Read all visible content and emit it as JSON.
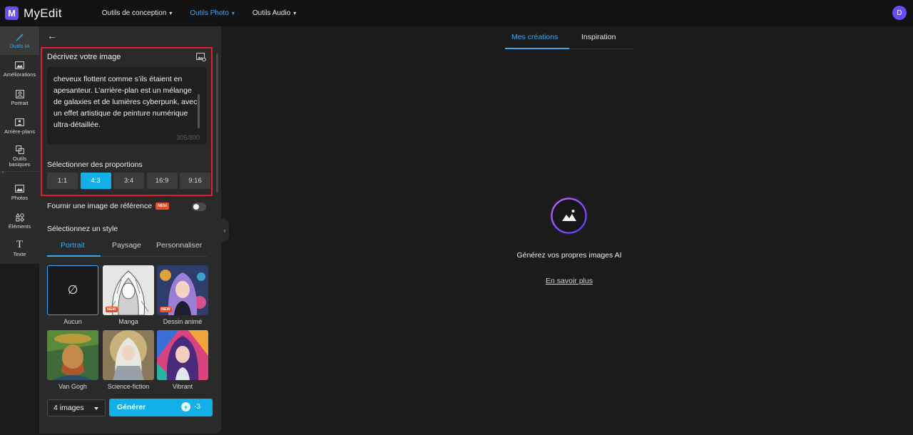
{
  "app": {
    "logo_mark": "M",
    "name": "MyEdit",
    "avatar_initial": "D"
  },
  "nav": [
    {
      "label": "Outils de conception",
      "active": false
    },
    {
      "label": "Outils Photo",
      "active": true
    },
    {
      "label": "Outils Audio",
      "active": false
    }
  ],
  "rail": {
    "ai": "Outils IA",
    "enhance": "Améliorations",
    "portrait": "Portrait",
    "backgrounds": "Arrière-plans",
    "basic": "Outils basiques",
    "photos": "Photos",
    "elements": "Éléments",
    "text": "Texte"
  },
  "panel": {
    "describe_title": "Décrivez votre image",
    "prompt_text": "cheveux flottent comme s’ils étaient en apesanteur. L’arrière-plan est un mélange de galaxies et de lumières cyberpunk, avec un effet artistique de peinture numérique ultra-détaillée.",
    "counter": "305/800",
    "ratio_title": "Sélectionner des proportions",
    "ratios": [
      "1:1",
      "4:3",
      "3:4",
      "16:9",
      "9:16"
    ],
    "ratio_selected": "4:3",
    "reference_label": "Fournir une image de référence",
    "new_badge": "NEW",
    "reference_enabled": false,
    "style_title": "Sélectionnez un style",
    "style_tabs": [
      "Portrait",
      "Paysage",
      "Personnaliser"
    ],
    "style_tab_active": "Portrait",
    "styles": [
      {
        "label": "Aucun",
        "new": false,
        "selected": true
      },
      {
        "label": "Manga",
        "new": true,
        "selected": false
      },
      {
        "label": "Dessin animé",
        "new": true,
        "selected": false
      },
      {
        "label": "Van Gogh",
        "new": false,
        "selected": false
      },
      {
        "label": "Science-fiction",
        "new": false,
        "selected": false
      },
      {
        "label": "Vibrant",
        "new": false,
        "selected": false
      }
    ],
    "image_count": "4 images",
    "generate_label": "Générer",
    "credit_cost": "-3"
  },
  "right": {
    "tabs": [
      "Mes créations",
      "Inspiration"
    ],
    "active_tab": "Mes créations",
    "empty_text": "Générez vos propres images AI",
    "learn_more": "En savoir plus"
  },
  "colors": {
    "accent": "#12b0e8",
    "link": "#3ba7f0",
    "brand": "#6a4cf5",
    "new_badge": "#f04a23",
    "highlight_border": "#e0202a"
  }
}
